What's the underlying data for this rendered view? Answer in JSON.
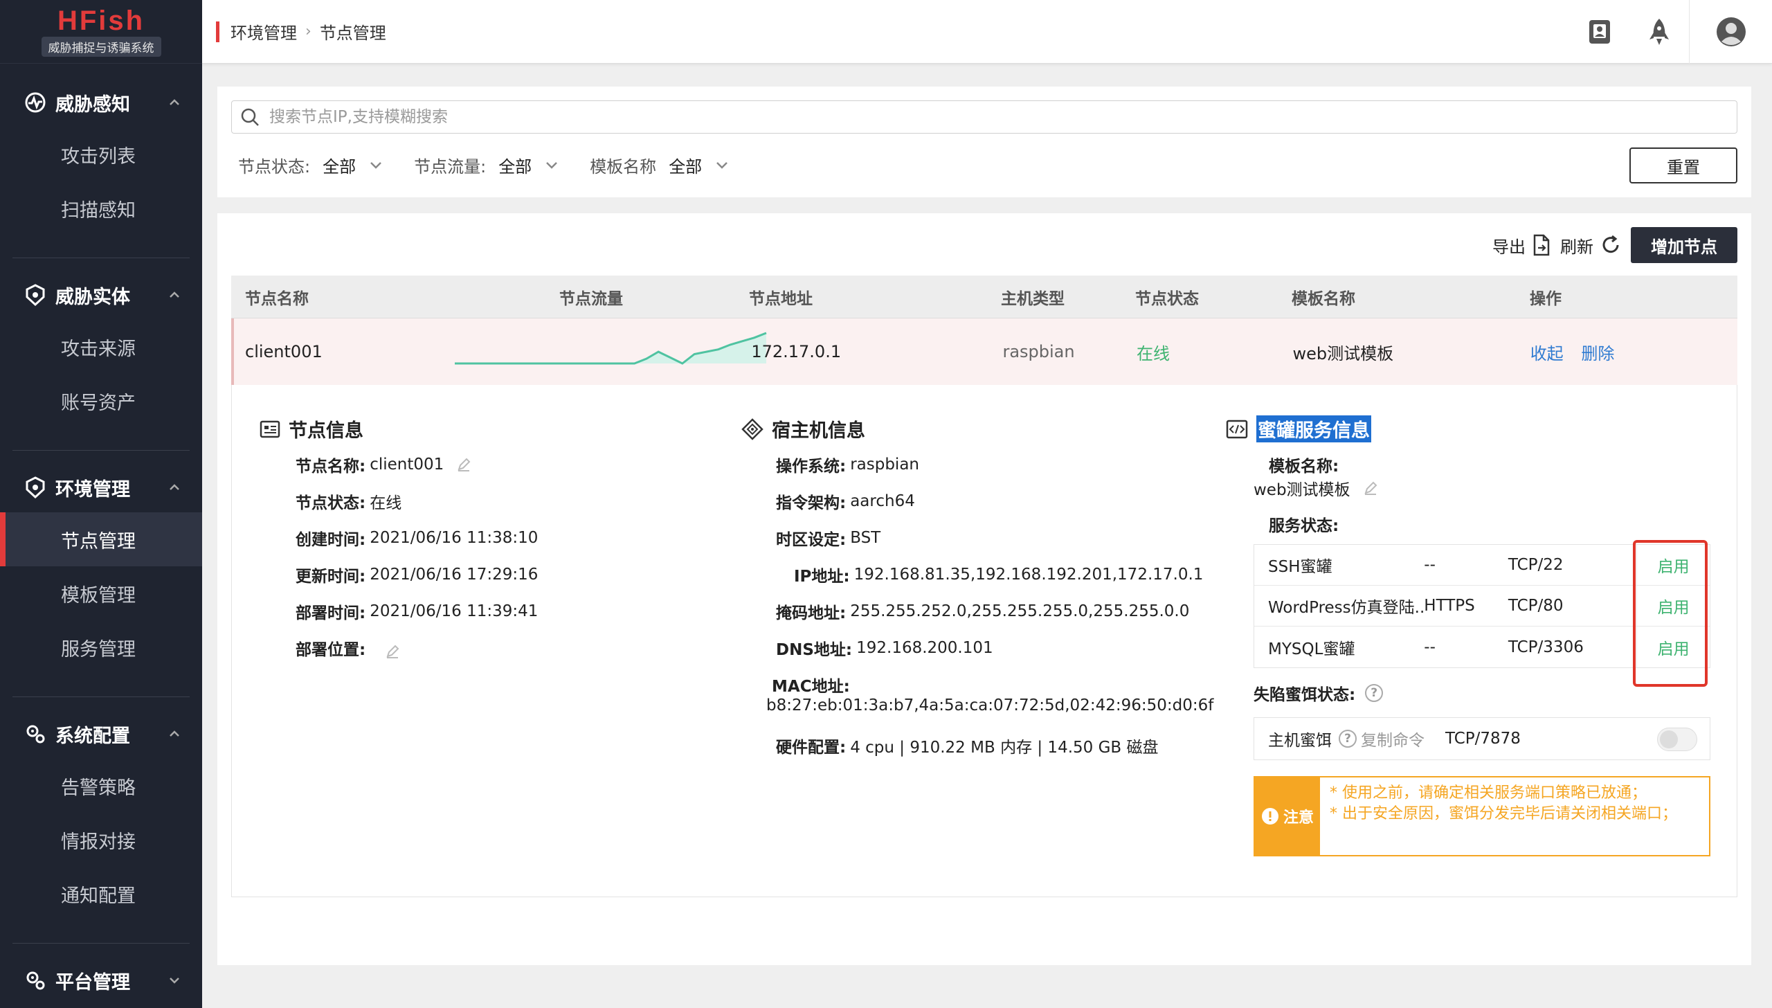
{
  "app": {
    "logo_title": "HFish",
    "logo_subtitle": "威胁捕捉与诱骗系统"
  },
  "sidebar": {
    "groups": [
      {
        "title": "威胁感知",
        "items": [
          "攻击列表",
          "扫描感知"
        ]
      },
      {
        "title": "威胁实体",
        "items": [
          "攻击来源",
          "账号资产"
        ]
      },
      {
        "title": "环境管理",
        "items": [
          "节点管理",
          "模板管理",
          "服务管理"
        ]
      },
      {
        "title": "系统配置",
        "items": [
          "告警策略",
          "情报对接",
          "通知配置"
        ]
      },
      {
        "title": "平台管理",
        "items": []
      }
    ],
    "active_item": "节点管理"
  },
  "breadcrumb": {
    "parent": "环境管理",
    "current": "节点管理"
  },
  "filters": {
    "search_placeholder": "搜索节点IP,支持模糊搜索",
    "status_label": "节点状态:",
    "status_value": "全部",
    "traffic_label": "节点流量:",
    "traffic_value": "全部",
    "template_label": "模板名称",
    "template_value": "全部",
    "reset": "重置"
  },
  "toolbar": {
    "export": "导出",
    "refresh": "刷新",
    "add": "增加节点"
  },
  "table": {
    "headers": [
      "节点名称",
      "节点流量",
      "节点地址",
      "主机类型",
      "节点状态",
      "模板名称",
      "操作"
    ],
    "row": {
      "name": "client001",
      "address": "172.17.0.1",
      "host_type": "raspbian",
      "status": "在线",
      "template": "web测试模板",
      "op_collapse": "收起",
      "op_delete": "删除"
    },
    "traffic_series": [
      0,
      0,
      0,
      0,
      0,
      0,
      0,
      0,
      0,
      0,
      0,
      0,
      0,
      0,
      0,
      0,
      0.4,
      1,
      0.5,
      0,
      0.8,
      1,
      1.2,
      1.6,
      1.9,
      2.2,
      2.6
    ]
  },
  "node_info": {
    "title": "节点信息",
    "name_k": "节点名称:",
    "name_v": "client001",
    "status_k": "节点状态:",
    "status_v": "在线",
    "created_k": "创建时间:",
    "created_v": "2021/06/16 11:38:10",
    "updated_k": "更新时间:",
    "updated_v": "2021/06/16 17:29:16",
    "deployed_k": "部署时间:",
    "deployed_v": "2021/06/16 11:39:41",
    "location_k": "部署位置:"
  },
  "host_info": {
    "title": "宿主机信息",
    "os_k": "操作系统:",
    "os_v": "raspbian",
    "arch_k": "指令架构:",
    "arch_v": "aarch64",
    "tz_k": "时区设定:",
    "tz_v": "BST",
    "ip_k": "IP地址:",
    "ip_v": "192.168.81.35,192.168.192.201,172.17.0.1",
    "mask_k": "掩码地址:",
    "mask_v": "255.255.252.0,255.255.255.0,255.255.0.0",
    "dns_k": "DNS地址:",
    "dns_v": "192.168.200.101",
    "mac_k": "MAC地址:",
    "mac_v": "b8:27:eb:01:3a:b7,4a:5a:ca:07:72:5d,02:42:96:50:d0:6f",
    "hw_k": "硬件配置:",
    "hw_v": "4 cpu | 910.22 MB 内存 | 14.50 GB 磁盘"
  },
  "honeypot_info": {
    "title": "蜜罐服务信息",
    "template_k": "模板名称:",
    "template_v": "web测试模板",
    "service_status_k": "服务状态:",
    "services": [
      {
        "name": "SSH蜜罐",
        "proto": "--",
        "port": "TCP/22",
        "status": "启用"
      },
      {
        "name": "WordPress仿真登陆...",
        "proto": "HTTPS",
        "port": "TCP/80",
        "status": "启用"
      },
      {
        "name": "MYSQL蜜罐",
        "proto": "--",
        "port": "TCP/3306",
        "status": "启用"
      }
    ],
    "bait_status_k": "失陷蜜饵状态:",
    "bait": {
      "name": "主机蜜饵",
      "copy": "复制命令",
      "port": "TCP/7878"
    },
    "notice": {
      "label": "注意",
      "line1": "* 使用之前，请确定相关服务端口策略已放通；",
      "line2": "* 出于安全原因，蜜饵分发完毕后请关闭相关端口；"
    }
  },
  "colors": {
    "accent": "#e23b3b",
    "online": "#3eb370",
    "link": "#2f7bd1",
    "notice": "#f5a623",
    "sidebar_bg": "#1f2430"
  }
}
